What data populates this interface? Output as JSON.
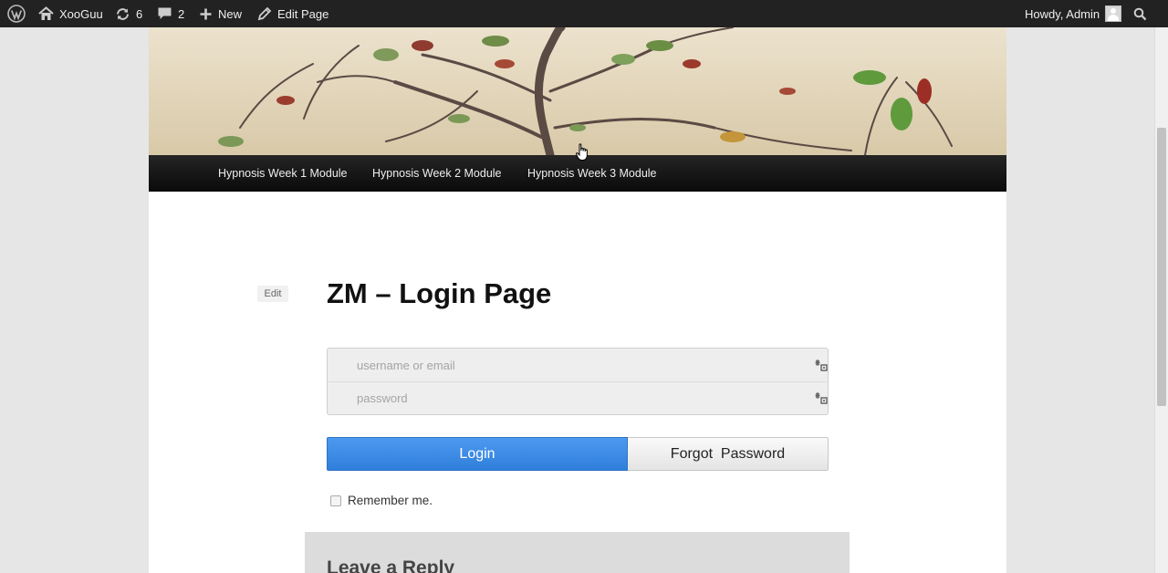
{
  "admin_bar": {
    "site_name": "XooGuu",
    "updates_count": "6",
    "comments_count": "2",
    "new_label": "New",
    "edit_page_label": "Edit Page",
    "greeting": "Howdy, Admin"
  },
  "nav": {
    "items": [
      {
        "label": "Hypnosis Week 1 Module"
      },
      {
        "label": "Hypnosis Week 2 Module"
      },
      {
        "label": "Hypnosis Week 3 Module"
      }
    ]
  },
  "page": {
    "edit_label": "Edit",
    "title": "ZM – Login Page"
  },
  "login_form": {
    "username_placeholder": "username or email",
    "password_placeholder": "password",
    "login_label": "Login",
    "forgot_label": "Forgot  Password",
    "remember_label": "Remember me."
  },
  "comments": {
    "heading": "Leave a Reply"
  },
  "colors": {
    "admin_bar_bg": "#222222",
    "nav_bg": "#111111",
    "login_button": "#3a8ae6",
    "page_bg": "#ffffff",
    "outer_bg": "#e6e6e6"
  },
  "icons": [
    "wordpress-icon",
    "home-icon",
    "updates-icon",
    "comments-icon",
    "plus-icon",
    "pencil-icon",
    "search-icon",
    "key-icon",
    "avatar-icon"
  ]
}
